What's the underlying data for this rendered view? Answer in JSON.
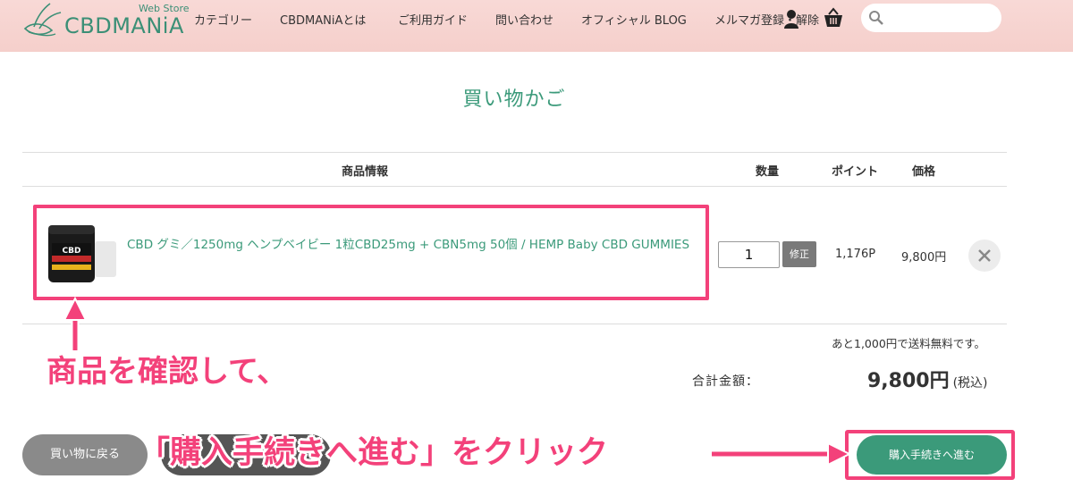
{
  "header": {
    "logo_text": "CBDMANiA",
    "logo_sub": "Web Store",
    "nav": [
      {
        "label": "カテゴリー"
      },
      {
        "label": "CBDMANiAとは"
      },
      {
        "label": "ご利用ガイド"
      },
      {
        "label": "問い合わせ"
      },
      {
        "label": "オフィシャル BLOG"
      },
      {
        "label": "メルマガ登録・解除"
      }
    ],
    "icons": [
      "user-icon",
      "cart-icon",
      "search-icon"
    ],
    "search_placeholder": ""
  },
  "page_title": "買い物かご",
  "table": {
    "headers": {
      "product": "商品情報",
      "quantity": "数量",
      "points": "ポイント",
      "price": "価格"
    },
    "rows": [
      {
        "name": "CBD グミ／1250mg ヘンプベイビー 1粒CBD25mg + CBN5mg 50個 / HEMP Baby CBD GUMMIES",
        "quantity": "1",
        "fix_label": "修正",
        "points": "1,176P",
        "price": "9,800円",
        "remove_icon": "close-icon"
      }
    ]
  },
  "summary": {
    "shipping_note": "あと1,000円で送料無料です。",
    "total_label": "合計金額：",
    "total_value": "9,800円",
    "total_tax": "(税込)"
  },
  "buttons": {
    "back": "買い物に戻る",
    "proceed": "購入手続きへ進む"
  },
  "annotations": {
    "check_product": "商品を確認して、",
    "click_proceed": "「購入手続きへ進む」をクリック"
  },
  "colors": {
    "accent": "#3b9a7a",
    "header_bg": "#f5cfcb",
    "highlight": "#f3417a"
  }
}
